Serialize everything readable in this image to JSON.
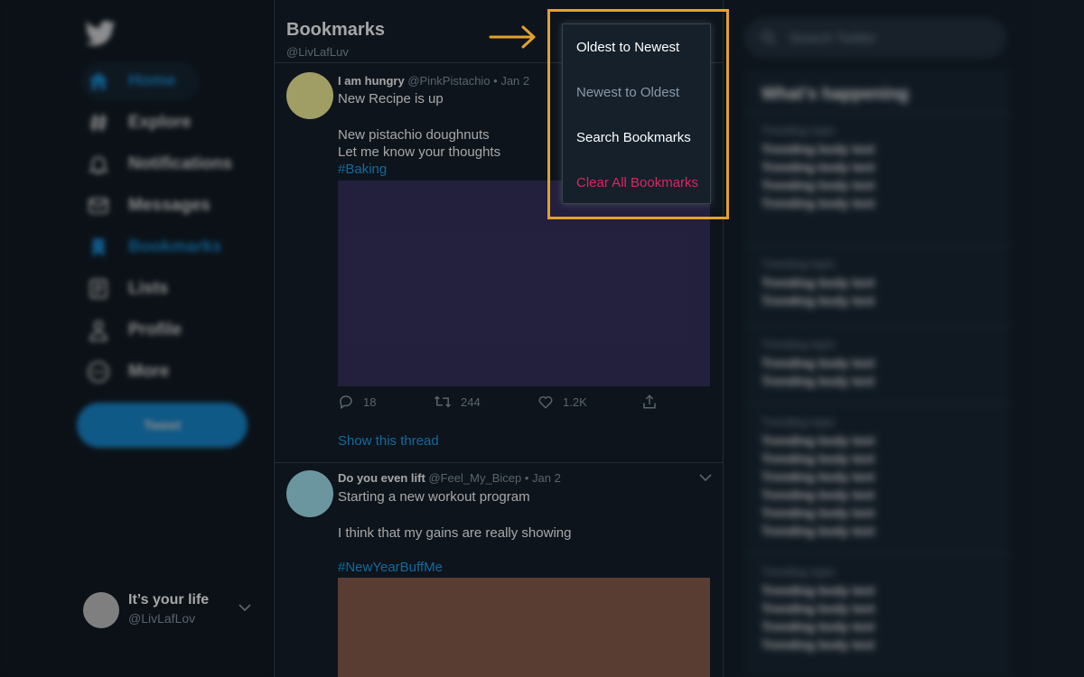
{
  "colors": {
    "background": "#15202b",
    "accent": "#1da1f2",
    "highlight": "#e3a12c",
    "danger": "#e0245e",
    "muted": "#8899a6"
  },
  "sidebar": {
    "logo_icon": "twitter-bird-icon",
    "items": [
      {
        "label": "Home",
        "icon": "home-icon"
      },
      {
        "label": "Explore",
        "icon": "hashtag-icon"
      },
      {
        "label": "Notifications",
        "icon": "bell-icon"
      },
      {
        "label": "Messages",
        "icon": "envelope-icon"
      },
      {
        "label": "Bookmarks",
        "icon": "bookmark-icon"
      },
      {
        "label": "Lists",
        "icon": "list-icon"
      },
      {
        "label": "Profile",
        "icon": "person-icon"
      },
      {
        "label": "More",
        "icon": "more-icon"
      }
    ],
    "tweet_button": "Tweet",
    "account": {
      "name": "It’s your life",
      "handle": "@LivLafLov"
    }
  },
  "header": {
    "title": "Bookmarks",
    "handle": "@LivLafLuv"
  },
  "menu": {
    "items": [
      {
        "label": "Oldest to Newest",
        "color": "#ffffff"
      },
      {
        "label": "Newest to Oldest",
        "color": "#8899a6"
      },
      {
        "label": "Search Bookmarks",
        "color": "#ffffff"
      },
      {
        "label": "Clear All Bookmarks",
        "color": "#e0245e"
      }
    ]
  },
  "tweets": [
    {
      "name": "I am hungry",
      "meta": "@PinkPistachio • Jan 2",
      "lines": [
        "New Recipe is up",
        "New pistachio doughnuts",
        "Let me know your thoughts"
      ],
      "hashtag": "#Baking",
      "avatar_color": "#f8f39b",
      "media_color": "#35325e",
      "stats": {
        "replies": "18",
        "retweets": "244",
        "likes": "1.2K"
      },
      "show_thread": "Show this thread"
    },
    {
      "name": "Do you even lift",
      "meta": "@Feel_My_Bicep • Jan 2",
      "lines": [
        "Starting a new workout program",
        "I think that my gains are really showing"
      ],
      "hashtag": "#NewYearBuffMe",
      "avatar_color": "#a6e7f5",
      "media_color": "#8a5e4d"
    }
  ],
  "right": {
    "search_placeholder": "Search Twitter",
    "trends_title": "What’s happening",
    "trend_topic": "Trending topic",
    "trend_body": "Trending body text"
  }
}
